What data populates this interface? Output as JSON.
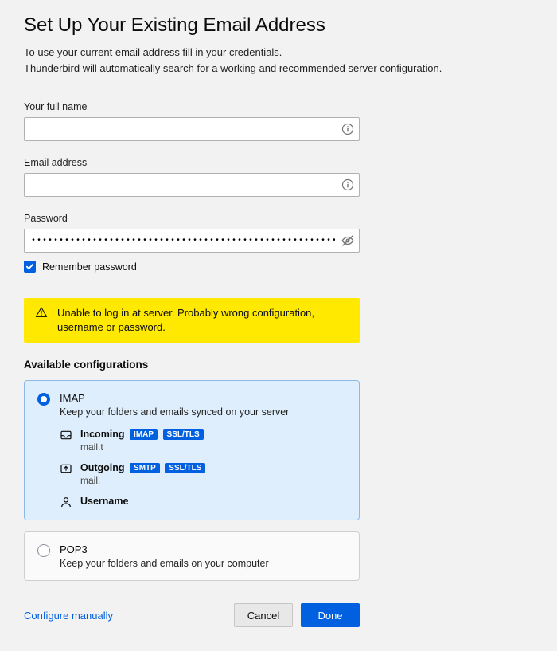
{
  "title": "Set Up Your Existing Email Address",
  "subtitle_line1": "To use your current email address fill in your credentials.",
  "subtitle_line2": "Thunderbird will automatically search for a working and recommended server configuration.",
  "fields": {
    "full_name": {
      "label": "Your full name",
      "value": ""
    },
    "email": {
      "label": "Email address",
      "value": ""
    },
    "password": {
      "label": "Password",
      "value": "•••••••••••••••••••••••••••••••••••••••••••••••••••••••••••••••••••••"
    }
  },
  "remember": {
    "label": "Remember password",
    "checked": true
  },
  "alert": "Unable to log in at server. Probably wrong configuration, username or password.",
  "configs_title": "Available configurations",
  "configs": {
    "imap": {
      "name": "IMAP",
      "desc": "Keep your folders and emails synced on your server",
      "incoming": {
        "label": "Incoming",
        "proto": "IMAP",
        "sec": "SSL/TLS",
        "host": "mail.t"
      },
      "outgoing": {
        "label": "Outgoing",
        "proto": "SMTP",
        "sec": "SSL/TLS",
        "host": "mail."
      },
      "username": {
        "label": "Username"
      }
    },
    "pop3": {
      "name": "POP3",
      "desc": "Keep your folders and emails on your computer"
    }
  },
  "footer": {
    "manual": "Configure manually",
    "cancel": "Cancel",
    "done": "Done"
  }
}
